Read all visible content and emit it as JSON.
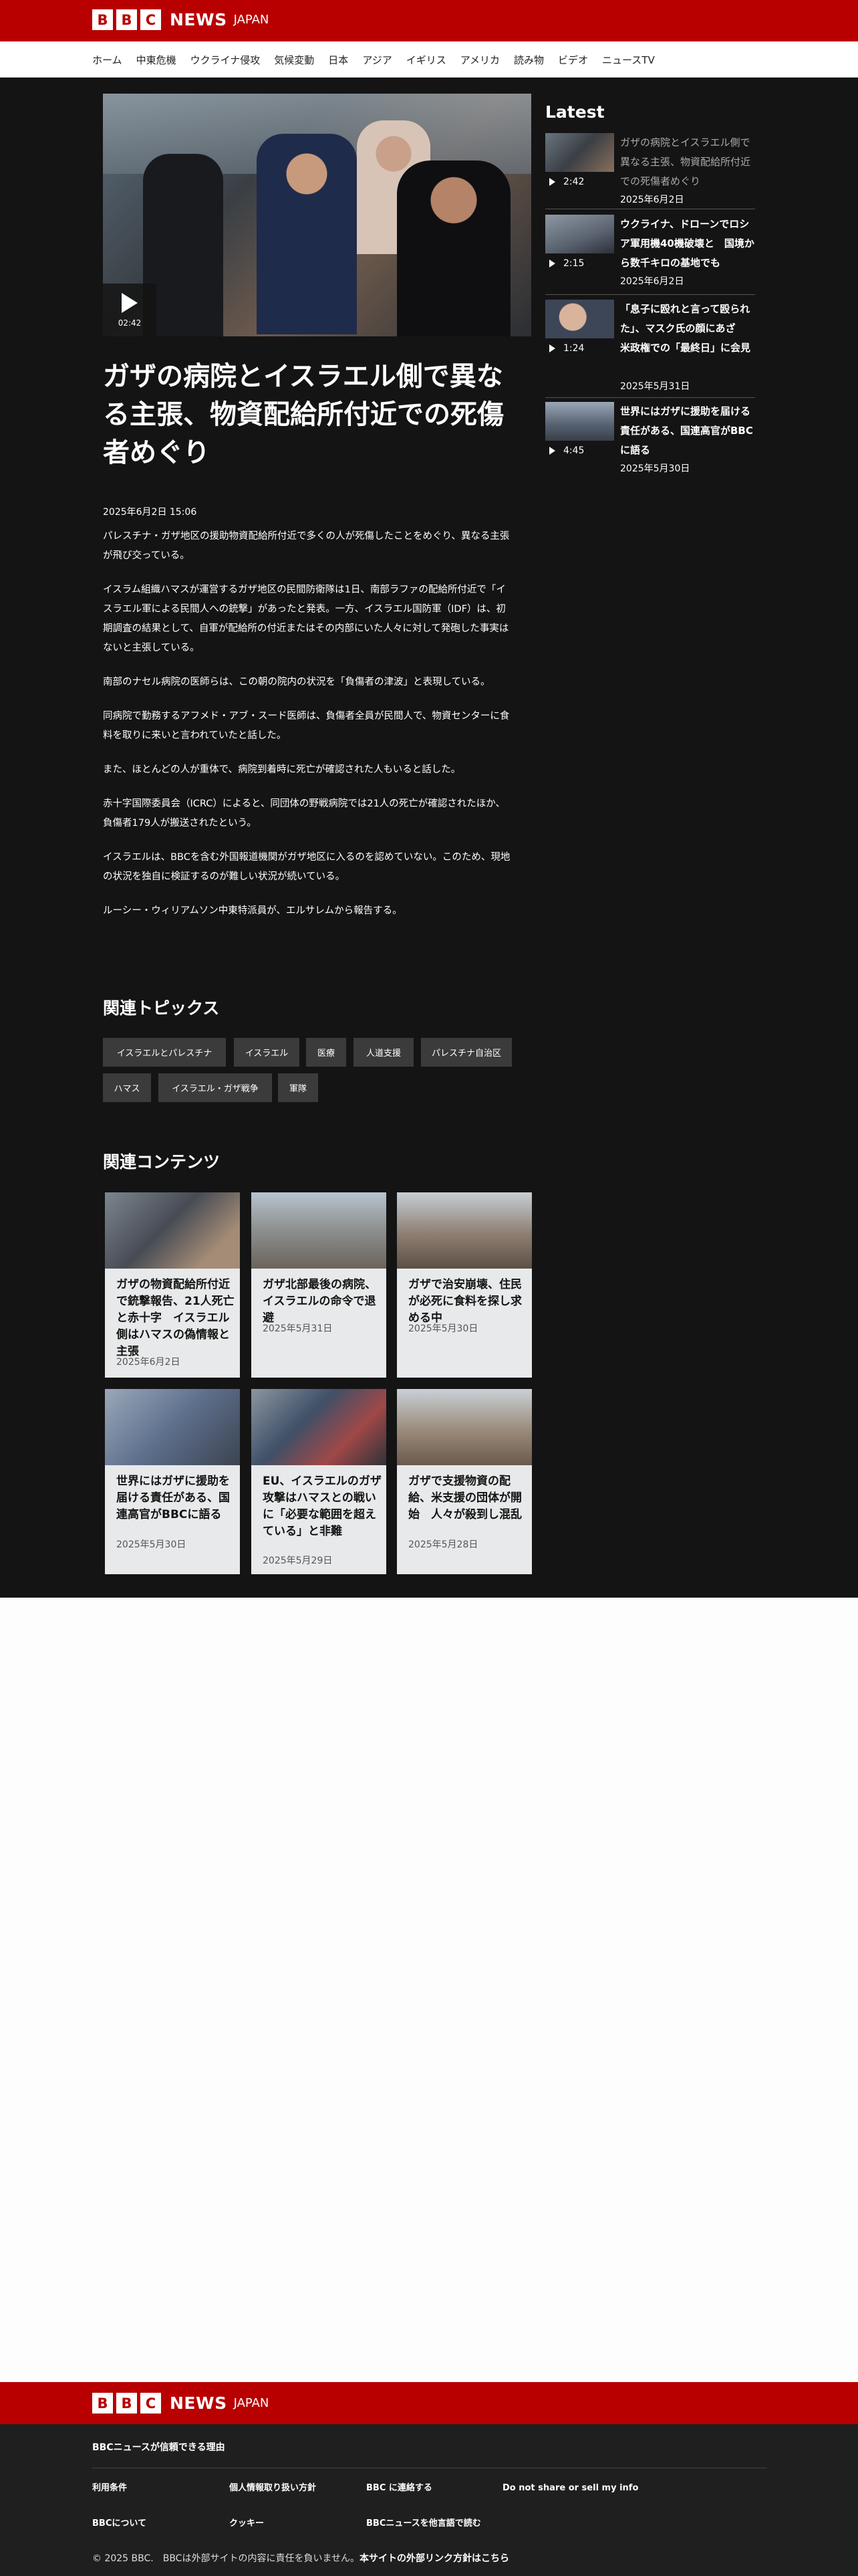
{
  "header": {
    "logo_letters": [
      "B",
      "B",
      "C"
    ],
    "brand": "NEWS",
    "region": "JAPAN"
  },
  "nav": [
    "ホーム",
    "中東危機",
    "ウクライナ侵攻",
    "気候変動",
    "日本",
    "アジア",
    "イギリス",
    "アメリカ",
    "読み物",
    "ビデオ",
    "ニュースTV"
  ],
  "article": {
    "video_duration": "02:42",
    "headline": "ガザの病院とイスラエル側で異なる主張、物資配給所付近での死傷者めぐり",
    "date": "2025年6月2日 15:06",
    "paragraphs": [
      "パレスチナ・ガザ地区の援助物資配給所付近で多くの人が死傷したことをめぐり、異なる主張が飛び交っている。",
      "イスラム組織ハマスが運営するガザ地区の民間防衛隊は1日、南部ラファの配給所付近で「イスラエル軍による民間人への銃撃」があったと発表。一方、イスラエル国防軍（IDF）は、初期調査の結果として、自軍が配給所の付近またはその内部にいた人々に対して発砲した事実はないと主張している。",
      "南部のナセル病院の医師らは、この朝の院内の状況を「負傷者の津波」と表現している。",
      "同病院で勤務するアフメド・アブ・スード医師は、負傷者全員が民間人で、物資センターに食料を取りに来いと言われていたと話した。",
      "また、ほとんどの人が重体で、病院到着時に死亡が確認された人もいると話した。",
      "赤十字国際委員会（ICRC）によると、同団体の野戦病院では21人の死亡が確認されたほか、負傷者179人が搬送されたという。",
      "イスラエルは、BBCを含む外国報道機関がガザ地区に入るのを認めていない。このため、現地の状況を独自に検証するのが難しい状況が続いている。",
      "ルーシー・ウィリアムソン中東特派員が、エルサレムから報告する。"
    ]
  },
  "latest": {
    "title": "Latest",
    "items": [
      {
        "duration": "2:42",
        "title": "ガザの病院とイスラエル側で異なる主張、物資配給所付近での死傷者めぐり",
        "date": "2025年6月2日"
      },
      {
        "duration": "2:15",
        "title": "ウクライナ、ドローンでロシア軍用機40機破壊と　国境から数千キロの基地でも",
        "date": "2025年6月2日"
      },
      {
        "duration": "1:24",
        "title": "「息子に殴れと言って殴られた」、マスク氏の顔にあざ　米政権での「最終日」に会見",
        "date": "2025年5月31日"
      },
      {
        "duration": "4:45",
        "title": "世界にはガザに援助を届ける責任がある、国連高官がBBCに語る",
        "date": "2025年5月30日"
      }
    ]
  },
  "topics": {
    "title": "関連トピックス",
    "items": [
      "イスラエルとパレスチナ",
      "イスラエル",
      "医療",
      "人道支援",
      "パレスチナ自治区",
      "ハマス",
      "イスラエル・ガザ戦争",
      "軍隊"
    ]
  },
  "related": {
    "title": "関連コンテンツ",
    "items": [
      {
        "title": "ガザの物資配給所付近で銃撃報告、21人死亡と赤十字　イスラエル側はハマスの偽情報と主張",
        "date": "2025年6月2日"
      },
      {
        "title": "ガザ北部最後の病院、イスラエルの命令で退避",
        "date": "2025年5月31日"
      },
      {
        "title": "ガザで治安崩壊、住民が必死に食料を探し求める中",
        "date": "2025年5月30日"
      },
      {
        "title": "世界にはガザに援助を届ける責任がある、国連高官がBBCに語る",
        "date": "2025年5月30日"
      },
      {
        "title": "EU、イスラエルのガザ攻撃はハマスとの戦いに「必要な範囲を超えている」と非難",
        "date": "2025年5月29日"
      },
      {
        "title": "ガザで支援物資の配給、米支援の団体が開始　人々が殺到し混乱",
        "date": "2025年5月28日"
      }
    ]
  },
  "footer": {
    "trust": "BBCニュースが信頼できる理由",
    "links": [
      "利用条件",
      "個人情報取り扱い方針",
      "BBC に連絡する",
      "Do not share or sell my info",
      "BBCについて",
      "クッキー",
      "BBCニュースを他言語で読む"
    ],
    "copyright": "© 2025 BBC.　BBCは外部サイトの内容に責任を負いません。",
    "external": "本サイトの外部リンク方針はこちら"
  }
}
